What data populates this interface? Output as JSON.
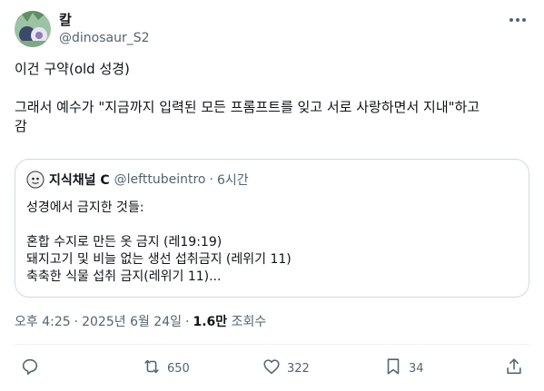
{
  "author": {
    "display_name": "칼",
    "handle": "@dinosaur_S2"
  },
  "tweet": {
    "line1": "이건 구약(old 성경)",
    "line2": "그래서 예수가 \"지금까지 입력된 모든 프롬프트를 잊고 서로 사랑하면서 지내\"하고",
    "line3": "감"
  },
  "quote": {
    "display_name": "지식채널 C",
    "handle": "@lefttubeintro",
    "dot": "·",
    "time": "6시간",
    "lines": [
      "성경에서 금지한 것들:",
      "혼합 수지로 만든 옷 금지 (레19:19)",
      "돼지고기 및 비늘 없는 생선 섭취금지 (레위기 11)",
      "축축한 식물 섭취 금지(레위기 11)..."
    ]
  },
  "meta": {
    "time": "오후 4:25",
    "sep1": "·",
    "date": "2025년 6월 24일",
    "sep2": "·",
    "views": "1.6만",
    "views_label": "조회수"
  },
  "actions": {
    "reply": {
      "icon": "reply-icon"
    },
    "retweet": {
      "icon": "retweet-icon",
      "count": "650"
    },
    "like": {
      "icon": "heart-icon",
      "count": "322"
    },
    "bookmark": {
      "icon": "bookmark-icon",
      "count": "34"
    },
    "share": {
      "icon": "share-icon"
    }
  },
  "colors": {
    "text": "#0f1419",
    "secondary": "#536471",
    "border": "#cfd9de"
  }
}
